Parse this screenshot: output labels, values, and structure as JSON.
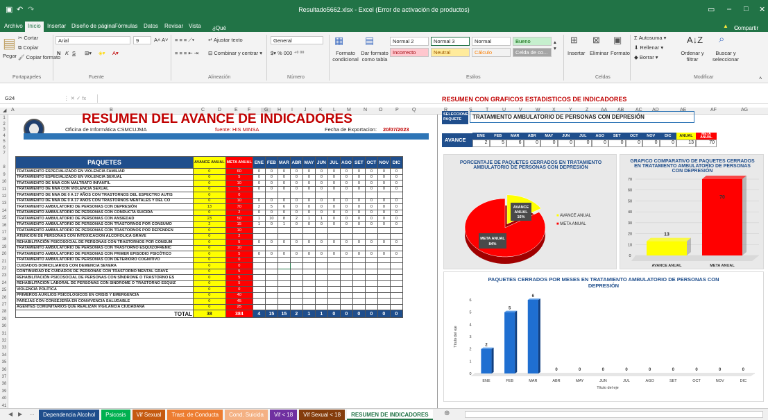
{
  "window": {
    "title": "Resultado5662.xlsx - Excel (Error de activación de productos)"
  },
  "menu": [
    "Archivo",
    "Inicio",
    "Insertar",
    "Diseño de página",
    "Fórmulas",
    "Datos",
    "Revisar",
    "Vista",
    "¿Qué desea hacer?"
  ],
  "menu_right": "Compartir",
  "ribbon": {
    "clipboard": {
      "paste": "Pegar",
      "cut": "Cortar",
      "copy": "Copiar",
      "format": "Copiar formato",
      "group": "Portapapeles"
    },
    "font": {
      "name": "Arial",
      "size": "9",
      "bold": "N",
      "italic": "K",
      "under": "S",
      "group": "Fuente"
    },
    "align": {
      "wrap": "Ajustar texto",
      "merge": "Combinar y centrar",
      "group": "Alineación"
    },
    "number": {
      "format": "General",
      "group": "Número"
    },
    "styles": {
      "cond": "Formato condicional",
      "table": "Dar formato como tabla",
      "group": "Estilos",
      "cells": [
        "Normal 2",
        "Normal 3",
        "Normal",
        "Bueno",
        "Incorrecto",
        "Neutral",
        "Cálculo",
        "Celda de co..."
      ]
    },
    "cells": {
      "insert": "Insertar",
      "delete": "Eliminar",
      "format": "Formato",
      "group": "Celdas"
    },
    "edit": {
      "autosum": "Autosuma",
      "fill": "Rellenar",
      "clear": "Borrar",
      "sort": "Ordenar y filtrar",
      "find": "Buscar y seleccionar",
      "group": "Modificar"
    }
  },
  "formula": {
    "cell": "G24",
    "fx": "fx"
  },
  "columns_left": [
    "A",
    "B",
    "C",
    "D",
    "E",
    "F",
    "G",
    "H",
    "I",
    "J",
    "K",
    "L",
    "M",
    "N",
    "O",
    "P",
    "Q"
  ],
  "columns_right": [
    "R",
    "S",
    "T",
    "U",
    "V",
    "W",
    "X",
    "Y",
    "Z",
    "AA",
    "AB",
    "AC",
    "AD",
    "AE",
    "AF",
    "AG"
  ],
  "left": {
    "title": "RESUMEN DEL AVANCE DE INDICADORES",
    "office": "Oficina de Informática CSMCUJMA",
    "source": "fuente: HIS MINSA",
    "export_label": "Fecha de Exportacion:",
    "export_date": "20/07/2023",
    "hdr": {
      "paquetes": "PAQUETES",
      "avance": "AVANCE ANUAL",
      "meta": "META ANUAL",
      "months": [
        "ENE",
        "FEB",
        "MAR",
        "ABR",
        "MAY",
        "JUN",
        "JUL",
        "AGO",
        "SET",
        "OCT",
        "NOV",
        "DIC"
      ]
    },
    "rows": [
      {
        "n": "TRATAMIENTO ESPECIALIZADO EN VIOLENCIA FAMILIAR",
        "a": "0",
        "m": "60",
        "v": [
          "0",
          "0",
          "0",
          "0",
          "0",
          "0",
          "0",
          "0",
          "0",
          "0",
          "0",
          "0"
        ]
      },
      {
        "n": "TRATAMIENTO ESPECIALIZADO EN VIOLENCIA SEXUAL",
        "a": "0",
        "m": "5",
        "v": [
          "0",
          "0",
          "0",
          "0",
          "0",
          "0",
          "0",
          "0",
          "0",
          "0",
          "0",
          "0"
        ]
      },
      {
        "n": "TRATAMIENTO DE NNA CON MALTRATO INFANTIL",
        "a": "0",
        "m": "10",
        "v": [
          "0",
          "0",
          "0",
          "0",
          "0",
          "0",
          "0",
          "0",
          "0",
          "0",
          "0",
          "0"
        ]
      },
      {
        "n": "TRATAMIENTO DE NNA CON VIOLENCIA SEXUAL",
        "a": "0",
        "m": "5",
        "v": [
          "0",
          "0",
          "0",
          "0",
          "0",
          "0",
          "0",
          "0",
          "0",
          "0",
          "0",
          "0"
        ]
      },
      {
        "n": "TRATAMIENTO DE NNA DE 0 A 17 AÑOS CON TRASTORNOS DEL ESPECTRO AUTIS",
        "a": "0",
        "m": "0",
        "v": [
          "",
          "",
          "",
          "",
          "",
          "",
          "",
          "",
          "",
          "",
          "",
          ""
        ]
      },
      {
        "n": "TRATAMIENTO DE NNA DE 0 A 17 AÑOS CON TRASTORNOS MENTALES Y DEL CO",
        "a": "0",
        "m": "10",
        "v": [
          "0",
          "0",
          "0",
          "0",
          "0",
          "0",
          "0",
          "0",
          "0",
          "0",
          "0",
          "0"
        ]
      },
      {
        "n": "TRATAMIENTO AMBULATORIO DE PERSONAS CON DEPRESIÓN",
        "a": "13",
        "m": "70",
        "v": [
          "2",
          "5",
          "6",
          "0",
          "0",
          "0",
          "0",
          "0",
          "0",
          "0",
          "0",
          "0"
        ]
      },
      {
        "n": "TRATAMIENTO AMBULATORIO DE PERSONAS CON CONDUCTA SUICIDA",
        "a": "0",
        "m": "2",
        "v": [
          "0",
          "0",
          "0",
          "0",
          "0",
          "0",
          "0",
          "0",
          "0",
          "0",
          "0",
          "0"
        ]
      },
      {
        "n": "TRATAMIENTO AMBULATORIO DE PERSONAS CON ANSIEDAD",
        "a": "23",
        "m": "50",
        "v": [
          "1",
          "10",
          "8",
          "2",
          "1",
          "1",
          "0",
          "0",
          "0",
          "0",
          "0",
          "0"
        ]
      },
      {
        "n": "TRATAMIENTO AMBULATORIO DE PERSONAS CON TRASTORNOS POR CONSUMO",
        "a": "2",
        "m": "15",
        "v": [
          "1",
          "0",
          "1",
          "0",
          "0",
          "0",
          "0",
          "0",
          "0",
          "0",
          "0",
          "0"
        ]
      },
      {
        "n": "TRATAMIENTO AMBULATORIO DE PERSONAS CON TRASTORNOS POR DEPENDEN",
        "a": "0",
        "m": "10",
        "v": [
          "",
          "",
          "",
          "",
          "",
          "",
          "",
          "",
          "",
          "",
          "",
          ""
        ]
      },
      {
        "n": "ATENCIÓN DE PERSONAS CON INTOXICACIÓN ALCOHÓLICA GRAVE",
        "a": "0",
        "m": "2",
        "v": [
          "",
          "",
          "",
          "",
          "",
          "",
          "",
          "",
          "",
          "",
          "",
          ""
        ]
      },
      {
        "n": "REHABILITACIÓN PSICOSOCIAL DE PERSONAS CON TRASTORNOS POR CONSUM",
        "a": "0",
        "m": "5",
        "v": [
          "0",
          "0",
          "0",
          "0",
          "0",
          "0",
          "0",
          "0",
          "0",
          "0",
          "0",
          "0"
        ]
      },
      {
        "n": "TRATAMIENTO AMBULATORIO DE PERSONAS CON TRASTORNO ESQUIZOFRÉNIC",
        "a": "0",
        "m": "10",
        "v": [
          "",
          "",
          "",
          "",
          "",
          "",
          "",
          "",
          "",
          "",
          "",
          ""
        ]
      },
      {
        "n": "TRATAMIENTO AMBULATORIO DE PERSONAS CON PRIMER EPISODIO PSICÓTICO",
        "a": "0",
        "m": "5",
        "v": [
          "0",
          "0",
          "0",
          "0",
          "0",
          "0",
          "0",
          "0",
          "0",
          "0",
          "0",
          "0"
        ]
      },
      {
        "n": "TRATAMIENTO AMBULATORIO DE PERSONAS CON DETERIORO COGNITIVO",
        "a": "0",
        "m": "0",
        "v": [
          "",
          "",
          "",
          "",
          "",
          "",
          "",
          "",
          "",
          "",
          "",
          ""
        ]
      },
      {
        "n": "CUIDADOS DOMICILIARIOS CON DEMENCIA SEVERA",
        "a": "0",
        "m": "0",
        "v": [
          "",
          "",
          "",
          "",
          "",
          "",
          "",
          "",
          "",
          "",
          "",
          ""
        ]
      },
      {
        "n": "CONTINUIDAD DE CUIDADOS DE PERSONAS CON TRASTORNO MENTAL GRAVE",
        "a": "0",
        "m": "5",
        "v": [
          "",
          "",
          "",
          "",
          "",
          "",
          "",
          "",
          "",
          "",
          "",
          ""
        ]
      },
      {
        "n": "REHABILITACIÓN PSICOSOCIAL DE PERSONAS CON SÍNDROME O TRASTORNO ES",
        "a": "0",
        "m": "5",
        "v": [
          "",
          "",
          "",
          "",
          "",
          "",
          "",
          "",
          "",
          "",
          "",
          ""
        ]
      },
      {
        "n": "REHABILITACIÓN LABORAL DE PERSONAS CON SÍNDROME O TRASTORNO ESQUIZ",
        "a": "0",
        "m": "5",
        "v": [
          "",
          "",
          "",
          "",
          "",
          "",
          "",
          "",
          "",
          "",
          "",
          ""
        ]
      },
      {
        "n": "VIOLENCIA POLÍTICA",
        "a": "0",
        "m": "0",
        "v": [
          "",
          "",
          "",
          "",
          "",
          "",
          "",
          "",
          "",
          "",
          "",
          ""
        ]
      },
      {
        "n": "PRIMEROS AUXILIOS PSICOLÓGICOS EN CRISIS Y EMERGENCIA",
        "a": "0",
        "m": "40",
        "v": [
          "",
          "",
          "",
          "",
          "",
          "",
          "",
          "",
          "",
          "",
          "",
          ""
        ]
      },
      {
        "n": "PAREJAS CON CONSEJERÍA EN CONVIVENCIA SALUDABLE",
        "a": "0",
        "m": "45",
        "v": [
          "",
          "",
          "",
          "",
          "",
          "",
          "",
          "",
          "",
          "",
          "",
          ""
        ]
      },
      {
        "n": "AGENTES COMUNITARIOS QUE REALIZAN VIGILANCIA CIUDADANA",
        "a": "0",
        "m": "25",
        "v": [
          "",
          "",
          "",
          "",
          "",
          "",
          "",
          "",
          "",
          "",
          "",
          ""
        ]
      }
    ],
    "total": {
      "label": "TOTAL",
      "a": "38",
      "m": "384",
      "v": [
        "4",
        "15",
        "15",
        "2",
        "1",
        "1",
        "0",
        "0",
        "0",
        "0",
        "0",
        "0"
      ]
    }
  },
  "right": {
    "title": "RESUMEN CON GRAFICOS ESTADISTICOS DE INDICADORES",
    "select_label": "SELECCIONE PAQUETE",
    "package": "TRATAMIENTO AMBULATORIO DE PERSONAS CON DEPRESIÓN",
    "avance_label": "AVANCE",
    "months": [
      "ENE",
      "FEB",
      "MAR",
      "ABR",
      "MAY",
      "JUN",
      "JUL",
      "AGO",
      "SET",
      "OCT",
      "NOV",
      "DIC"
    ],
    "month_values": [
      "2",
      "5",
      "6",
      "0",
      "0",
      "0",
      "0",
      "0",
      "0",
      "0",
      "0",
      "0"
    ],
    "anual_label": "ANUAL",
    "anual": "13",
    "meta_label": "META ANUAL",
    "meta": "70"
  },
  "chart_data": [
    {
      "type": "pie",
      "title": "PORCENTAJE DE PAQUETES CERRADOS EN TRATAMIENTO AMBULATORIO DE PERSONAS CON DEPRESIÓN",
      "series": [
        {
          "name": "AVANCE ANUAL",
          "value": 16,
          "label": "16%",
          "color": "#ffff00"
        },
        {
          "name": "META ANUAL",
          "value": 84,
          "label": "84%",
          "color": "#ff0000"
        }
      ]
    },
    {
      "type": "bar",
      "title": "GRAFICO COMPARATIVO DE PAQUETES CERRADOS EN TRATAMIENTO AMBULATORIO DE PERSONAS CON DEPRESIÓN",
      "categories": [
        "AVANCE ANUAL",
        "META ANUAL"
      ],
      "values": [
        13,
        70
      ],
      "colors": [
        "#ffff00",
        "#ff0000"
      ],
      "ylim": [
        0,
        70
      ],
      "yticks": [
        "0",
        "10",
        "20",
        "30",
        "40",
        "50",
        "60",
        "70"
      ]
    },
    {
      "type": "bar",
      "title": "PAQUETES CERRADOS POR MESES EN TRATAMIENTO AMBULATORIO DE PERSONAS CON DEPRESIÓN",
      "categories": [
        "ENE",
        "FEB",
        "MAR",
        "ABR",
        "MAY",
        "JUN",
        "JUL",
        "AGO",
        "SET",
        "OCT",
        "NOV",
        "DIC"
      ],
      "values": [
        2,
        5,
        6,
        0,
        0,
        0,
        0,
        0,
        0,
        0,
        0,
        0
      ],
      "xlabel": "Título del eje",
      "ylabel": "Título del eje",
      "ylim": [
        0,
        6
      ],
      "yticks": [
        "0",
        "1",
        "2",
        "3",
        "4",
        "5",
        "6"
      ],
      "color": "#1f6fd1"
    }
  ],
  "sheet_tabs": [
    {
      "label": "Dependencia Alcohol",
      "color": "#1f4e8c"
    },
    {
      "label": "Psicosis",
      "color": "#00b050"
    },
    {
      "label": "Vif Sexual",
      "color": "#c55a11"
    },
    {
      "label": "Trast. de Conducta",
      "color": "#ed7d31"
    },
    {
      "label": "Cond. Suicida",
      "color": "#f4b183"
    },
    {
      "label": "Vif < 18",
      "color": "#7030a0"
    },
    {
      "label": "Vif Sexual < 18",
      "color": "#843c0c"
    },
    {
      "label": "RESUMEN DE INDICADORES",
      "color": "#ffffff"
    }
  ]
}
